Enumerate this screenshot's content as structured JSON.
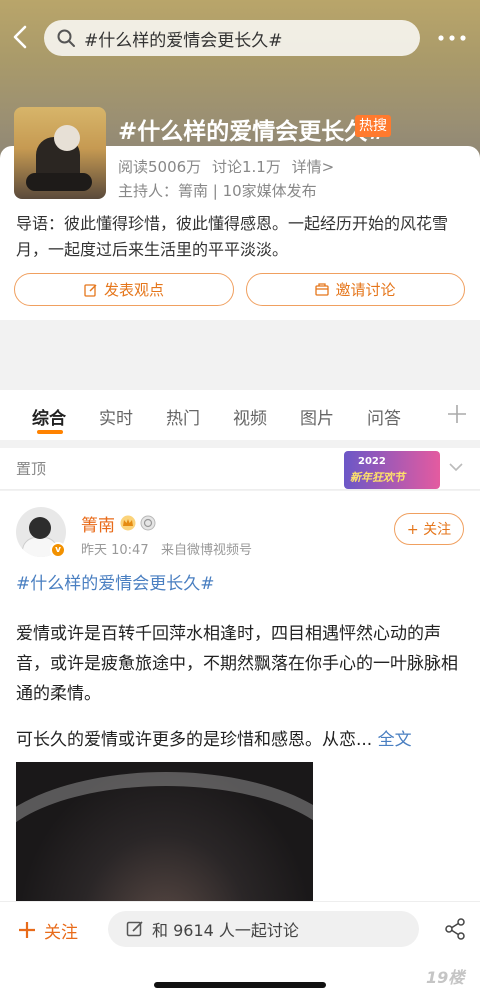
{
  "header": {
    "search_text": "#什么样的爱情会更长久#",
    "topic_title": "#什么样的爱情会更长久#",
    "hot_badge": "热搜",
    "stats": {
      "reads": "阅读5006万",
      "discussions": "讨论1.1万",
      "details": "详情>"
    },
    "host": "主持人：箐南 | 10家媒体发布",
    "guide": "导语：彼此懂得珍惜，彼此懂得感恩。一起经历开始的风花雪月，一起度过后来生活里的平平淡淡。",
    "post_button": "发表观点",
    "invite_button": "邀请讨论"
  },
  "tabs": [
    "综合",
    "实时",
    "热门",
    "视频",
    "图片",
    "问答"
  ],
  "pinned": {
    "label": "置顶",
    "banner_year": "2022",
    "banner_title": "新年狂欢节"
  },
  "post": {
    "username": "箐南",
    "time": "昨天 10:47",
    "source": "来自微博视频号",
    "follow": "+ 关注",
    "hashtag": "#什么样的爱情会更长久#",
    "paragraph1": "爱情或许是百转千回萍水相逢时，四目相遇怦然心动的声音，或许是疲惫旅途中，不期然飘落在你手心的一叶脉脉相通的柔情。",
    "paragraph2": "可长久的爱情或许更多的是珍惜和感恩。从恋...",
    "fulltext": "全文"
  },
  "bottom": {
    "follow": "关注",
    "discuss": "和 9614 人一起讨论",
    "watermark": "19楼"
  },
  "colors": {
    "accent": "#ff8200",
    "link": "#4a7fc1",
    "hot": "#ff7a2e"
  },
  "icons": [
    "back-icon",
    "search-icon",
    "more-icon",
    "edit-icon",
    "invite-icon",
    "plus-icon",
    "chevron-down-icon",
    "verified-icon",
    "share-icon"
  ]
}
